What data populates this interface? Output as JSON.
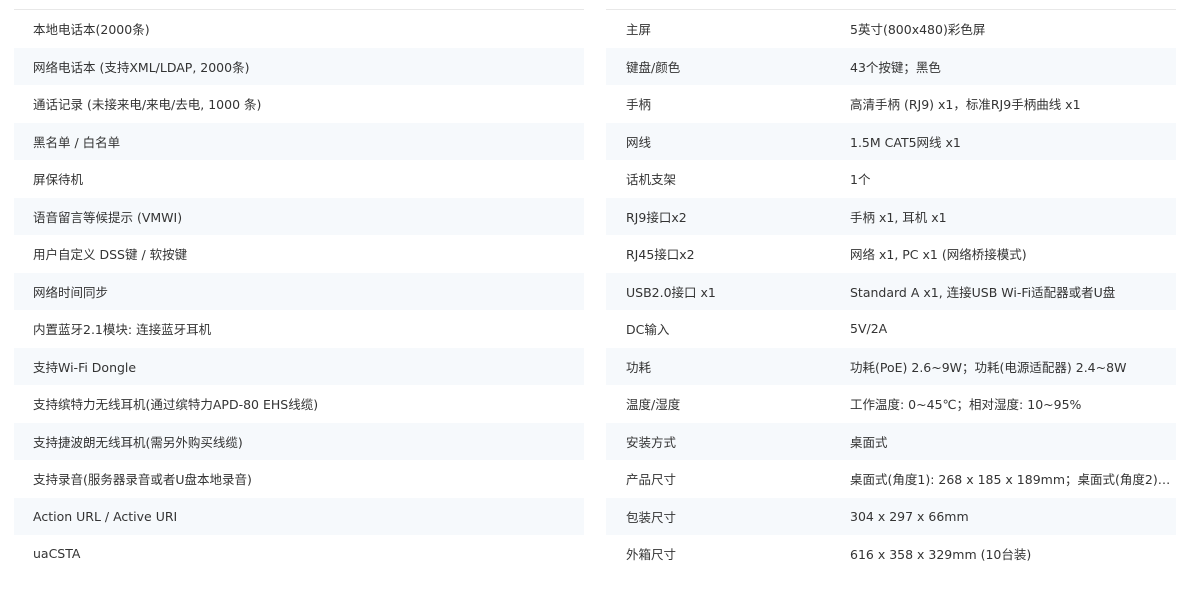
{
  "features": [
    "本地电话本(2000条)",
    "网络电话本 (支持XML/LDAP, 2000条)",
    "通话记录 (未接来电/来电/去电, 1000 条)",
    "黑名单 / 白名单",
    "屏保待机",
    "语音留言等候提示 (VMWI)",
    "用户自定义 DSS键 / 软按键",
    "网络时间同步",
    "内置蓝牙2.1模块: 连接蓝牙耳机",
    "支持Wi-Fi Dongle",
    "支持缤特力无线耳机(通过缤特力APD-80 EHS线缆)",
    "支持捷波朗无线耳机(需另外购买线缆)",
    "支持录音(服务器录音或者U盘本地录音)",
    "Action URL / Active URI",
    "uaCSTA"
  ],
  "specs": [
    {
      "key": "主屏",
      "value": "5英寸(800x480)彩色屏"
    },
    {
      "key": "键盘/颜色",
      "value": "43个按键；黑色"
    },
    {
      "key": "手柄",
      "value": "高清手柄 (RJ9) x1，标准RJ9手柄曲线 x1"
    },
    {
      "key": "网线",
      "value": "1.5M CAT5网线 x1"
    },
    {
      "key": "话机支架",
      "value": "1个"
    },
    {
      "key": "RJ9接口x2",
      "value": "手柄 x1, 耳机 x1"
    },
    {
      "key": "RJ45接口x2",
      "value": "网络 x1, PC x1 (网络桥接模式)"
    },
    {
      "key": "USB2.0接口 x1",
      "value": "Standard A x1, 连接USB Wi-Fi适配器或者U盘"
    },
    {
      "key": "DC输入",
      "value": "5V/2A"
    },
    {
      "key": "功耗",
      "value": "功耗(PoE) 2.6~9W；功耗(电源适配器) 2.4~8W"
    },
    {
      "key": "温度/湿度",
      "value": "工作温度: 0~45℃；相对湿度: 10~95%"
    },
    {
      "key": "安装方式",
      "value": "桌面式"
    },
    {
      "key": "产品尺寸",
      "value": "桌面式(角度1): 268 x 185 x 189mm；桌面式(角度2): 2…"
    },
    {
      "key": "包装尺寸",
      "value": "304 x 297 x 66mm"
    },
    {
      "key": "外箱尺寸",
      "value": "616 x 358 x 329mm (10台装)"
    }
  ]
}
